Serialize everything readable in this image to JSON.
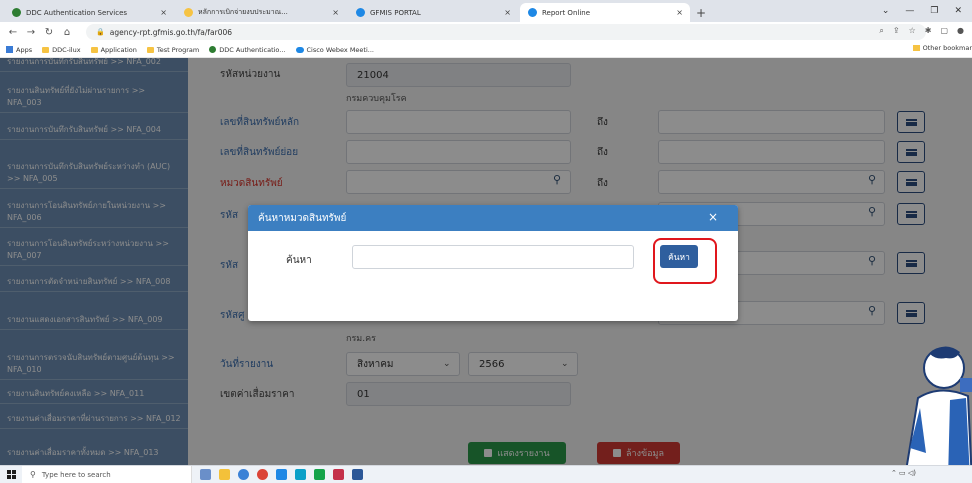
{
  "browser": {
    "tabs": [
      {
        "label": "DDC Authentication Services",
        "active": false,
        "color": "#2e7d32"
      },
      {
        "label": "หลักการเบิกจ่ายงบประมาณ...",
        "active": false,
        "color": "#f6c343"
      },
      {
        "label": "GFMIS PORTAL",
        "active": false,
        "color": "#1e88e5"
      },
      {
        "label": "Report Online",
        "active": true,
        "color": "#1e88e5"
      }
    ],
    "tab_close": "×",
    "new_tab": "+",
    "url": "agency-rpt.gfmis.go.th/fa/far006",
    "bookmarks": [
      "Apps",
      "DDC-ilux",
      "Application",
      "Test Program",
      "DDC Authenticatio...",
      "Cisco Webex Meeti..."
    ],
    "other_bookmarks": "Other bookmar"
  },
  "sidebar": {
    "items": [
      {
        "label": "รายงานการบันทึกรับสินทรัพย์ >> NFA_002"
      },
      {
        "label": "รายงานสินทรัพย์ที่ยังไม่ผ่านรายการ >> NFA_003"
      },
      {
        "label": "รายงานการบันทึกรับสินทรัพย์ >> NFA_004"
      },
      {
        "label": "รายงานการบันทึกรับสินทรัพย์ระหว่างทำ (AUC) >> NFA_005"
      },
      {
        "label": "รายงานการโอนสินทรัพย์ภายในหน่วยงาน >> NFA_006"
      },
      {
        "label": "รายงานการโอนสินทรัพย์ระหว่างหน่วยงาน >> NFA_007"
      },
      {
        "label": "รายงานการตัดจำหน่ายสินทรัพย์ >> NFA_008"
      },
      {
        "label": "รายงานแสดงเอกสารสินทรัพย์ >> NFA_009"
      },
      {
        "label": "รายงานการตรวจนับสินทรัพย์ตามศูนย์ต้นทุน >> NFA_010"
      },
      {
        "label": "รายงานสินทรัพย์คงเหลือ >> NFA_011"
      },
      {
        "label": "รายงานค่าเสื่อมราคาที่ผ่านรายการ >> NFA_012"
      },
      {
        "label": "รายงานค่าเสื่อมราคาทั้งหมด >> NFA_013"
      }
    ]
  },
  "form": {
    "unit_code_label": "รหัสหน่วยงาน",
    "unit_code_value": "21004",
    "unit_name": "กรมควบคุมโรค",
    "main_asset_label": "เลขที่สินทรัพย์หลัก",
    "sub_asset_label": "เลขที่สินทรัพย์ย่อย",
    "asset_category_label": "หมวดสินทรัพย์",
    "to_label": "ถึง",
    "row4_label": "รหัส",
    "row5_label": "รหัส",
    "row6_label": "รหัสศู",
    "row6_sub": "กรม.คร",
    "report_date_label": "วันที่รายงาน",
    "month_value": "สิงหาคม",
    "year_value": "2566",
    "depr_period_label": "เขตค่าเสื่อมราคา",
    "depr_period_value": "01",
    "show_report_button": "แสดงรายงาน",
    "clear_button": "ล้างข้อมูล",
    "search_icon": "magnifier-icon",
    "list_icon": "list-icon",
    "dropdown_icon": "chevron-down-icon"
  },
  "modal": {
    "title": "ค้นหาหมวดสินทรัพย์",
    "close": "×",
    "search_label": "ค้นหา",
    "search_value": "",
    "search_button": "ค้นหา",
    "highlight_color": "#e0171d"
  },
  "taskbar": {
    "search_placeholder": "Type here to search"
  }
}
